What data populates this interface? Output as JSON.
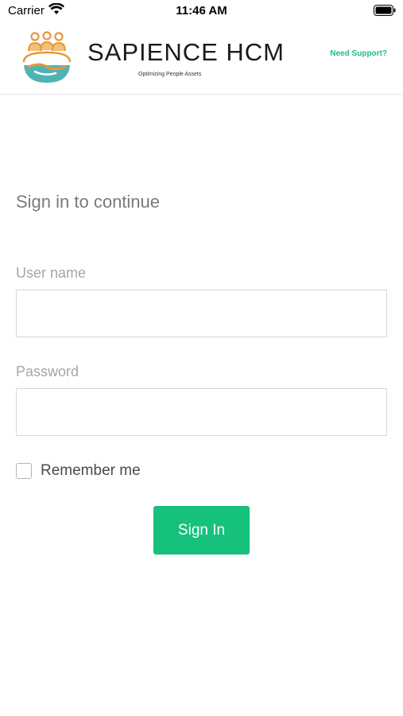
{
  "status_bar": {
    "carrier": "Carrier",
    "time": "11:46 AM",
    "wifi_icon": "wifi-icon",
    "battery_icon": "battery-icon"
  },
  "header": {
    "logo_icon": "people-handshake-logo-icon",
    "brand_name": "SAPIENCE HCM",
    "tagline": "Optimizing People Assets",
    "support_link": "Need Support?"
  },
  "form": {
    "title": "Sign in to continue",
    "username_label": "User name",
    "username_value": "",
    "password_label": "Password",
    "password_value": "",
    "remember_label": "Remember me",
    "remember_checked": false,
    "submit_label": "Sign In"
  },
  "colors": {
    "accent": "#16c17c",
    "link": "#1cbf7a",
    "logo_orange": "#e8963c",
    "logo_teal": "#4fb3b5"
  }
}
